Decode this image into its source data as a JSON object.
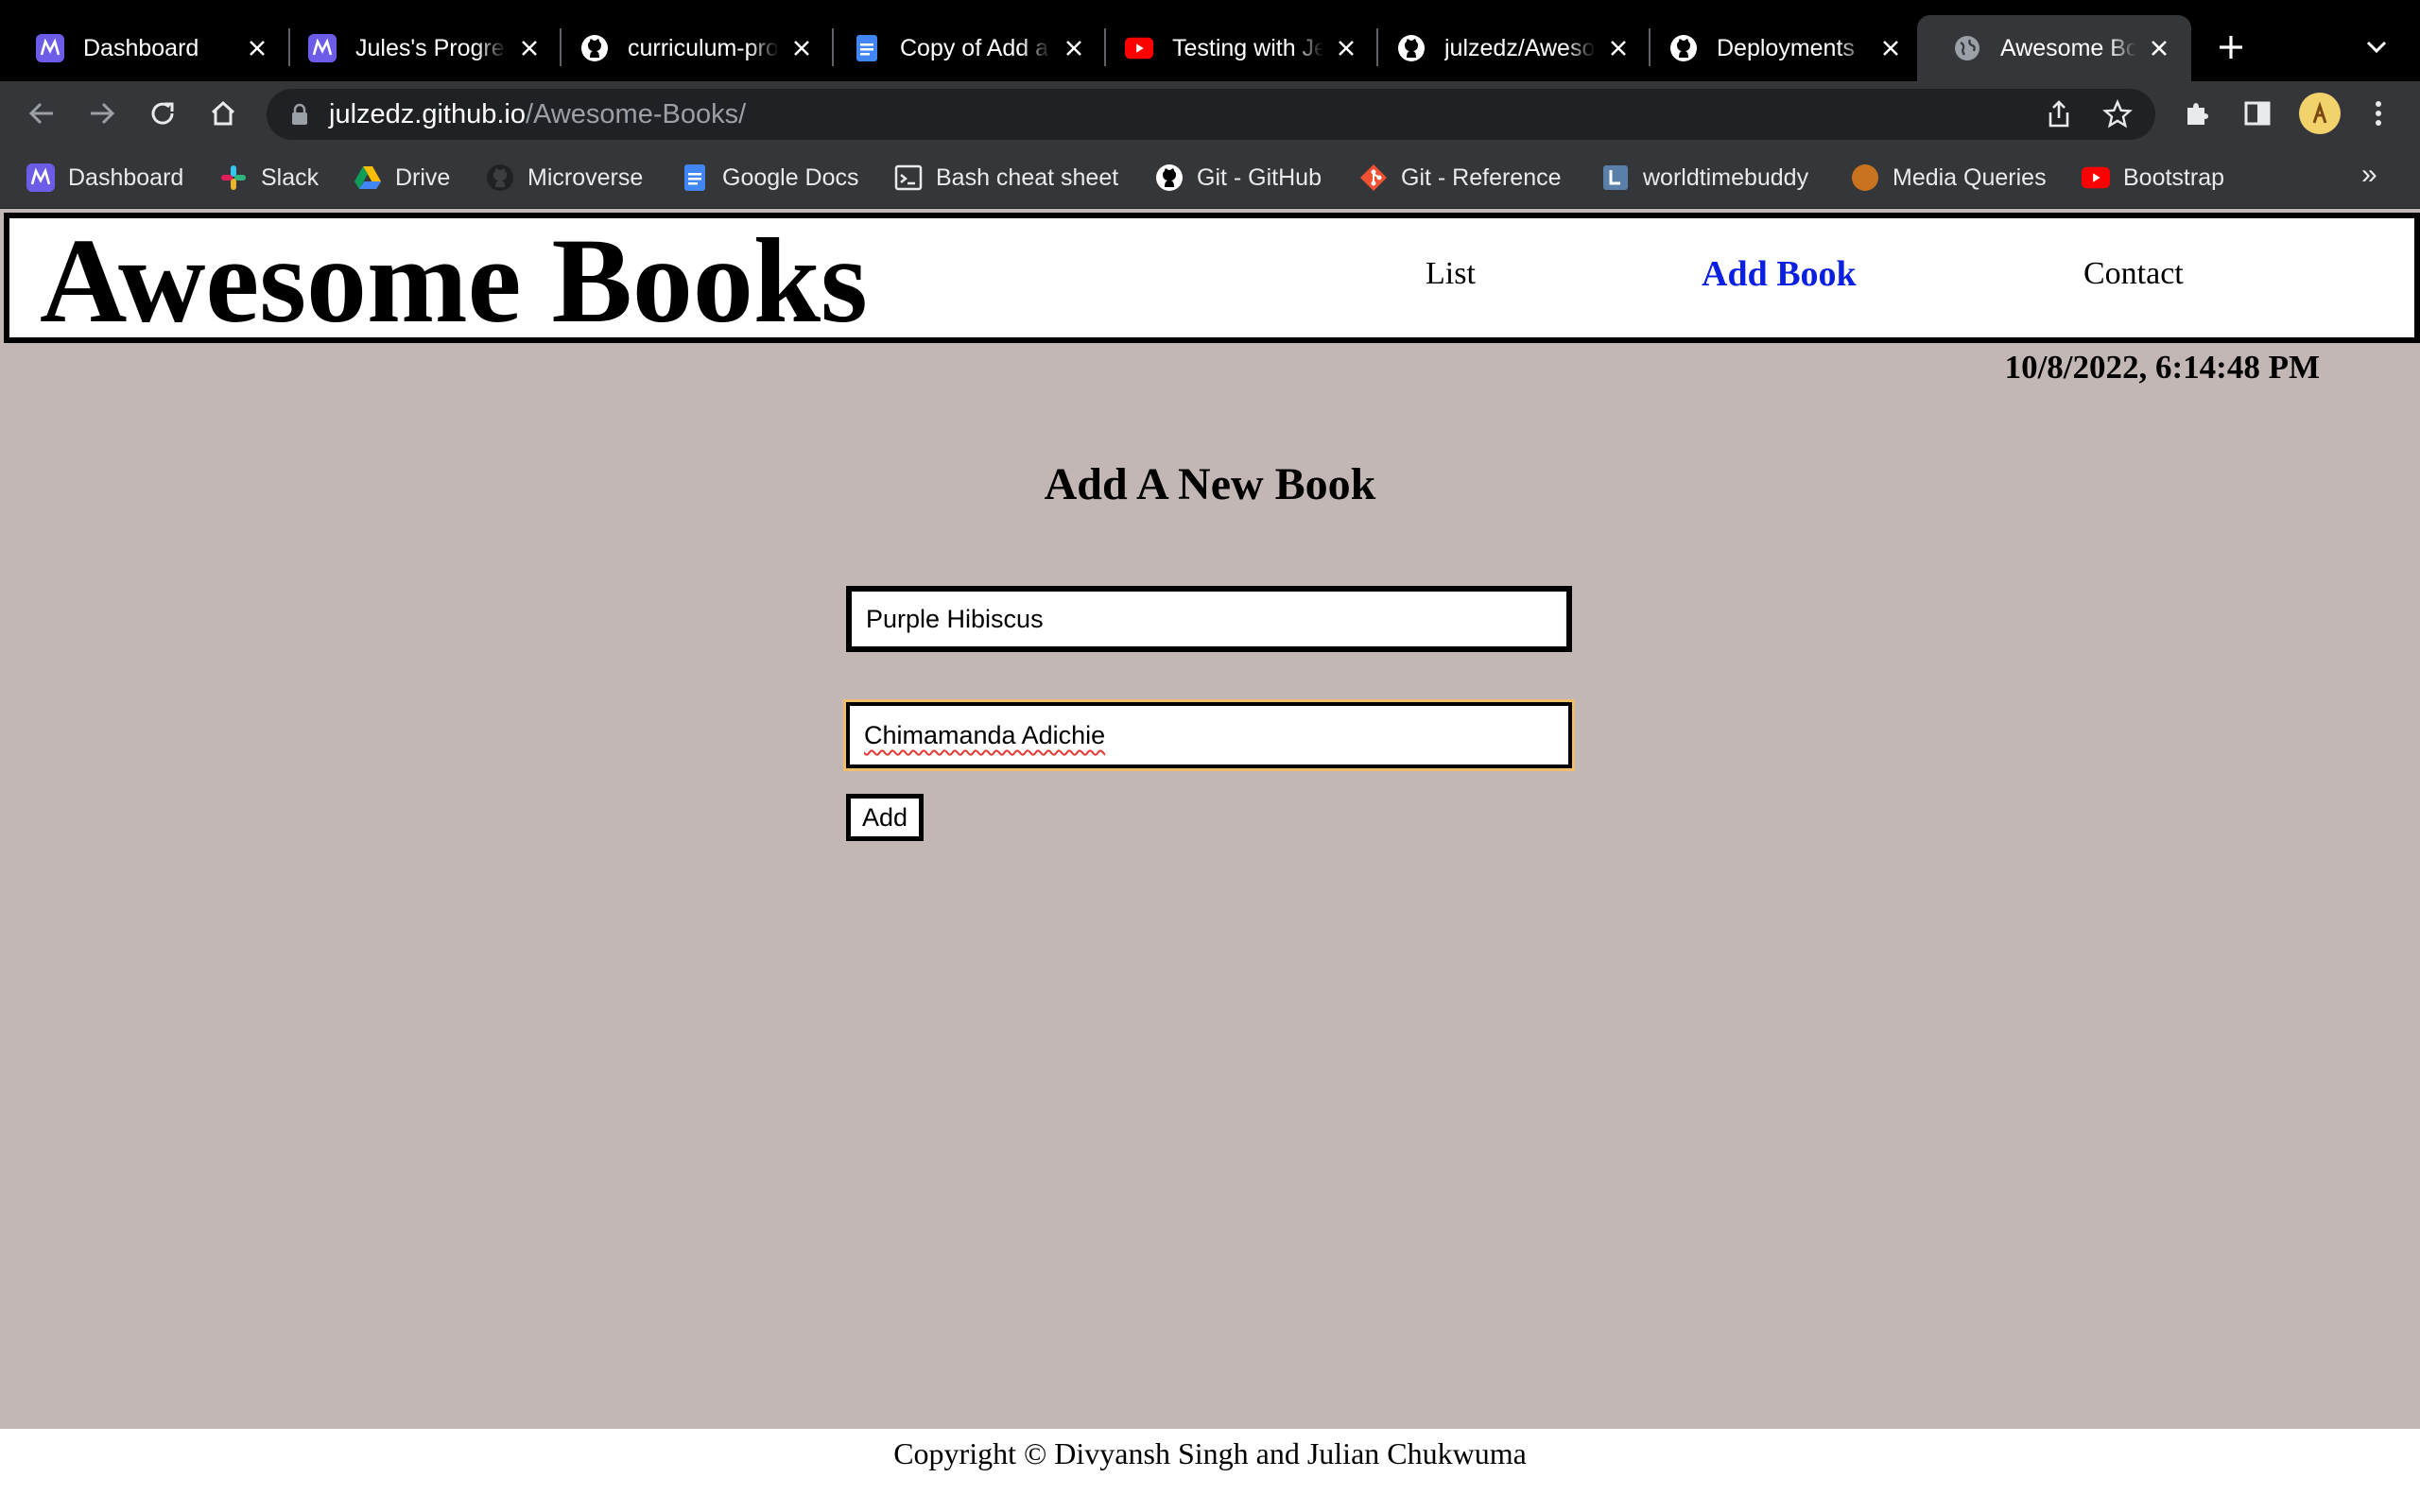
{
  "browser": {
    "tabs": [
      {
        "title": "Dashboard",
        "icon": "microverse-icon"
      },
      {
        "title": "Jules's Progress",
        "icon": "microverse-icon"
      },
      {
        "title": "curriculum-products",
        "icon": "github-icon"
      },
      {
        "title": "Copy of Add a",
        "icon": "google-docs-icon"
      },
      {
        "title": "Testing with Jest",
        "icon": "youtube-icon"
      },
      {
        "title": "julzedz/Awesome",
        "icon": "github-icon"
      },
      {
        "title": "Deployments",
        "icon": "github-icon"
      },
      {
        "title": "Awesome Books",
        "icon": "globe-icon",
        "active": true
      }
    ],
    "url_host": "julzedz.github.io",
    "url_path": "/Awesome-Books/",
    "bookmarks": [
      {
        "label": "Dashboard",
        "icon": "microverse-icon"
      },
      {
        "label": "Slack",
        "icon": "slack-icon"
      },
      {
        "label": "Drive",
        "icon": "google-drive-icon"
      },
      {
        "label": "Microverse",
        "icon": "github-icon"
      },
      {
        "label": "Google Docs",
        "icon": "google-docs-icon"
      },
      {
        "label": "Bash cheat sheet",
        "icon": "terminal-icon"
      },
      {
        "label": "Git - GitHub",
        "icon": "github-icon"
      },
      {
        "label": "Git - Reference",
        "icon": "git-icon"
      },
      {
        "label": "worldtimebuddy",
        "icon": "worldtimebuddy-icon"
      },
      {
        "label": "Media Queries",
        "icon": "orange-circle-icon"
      },
      {
        "label": "Bootstrap",
        "icon": "youtube-icon"
      }
    ],
    "bookmarks_more": "»"
  },
  "site": {
    "logo": "Awesome Books",
    "nav": {
      "list": "List",
      "add": "Add Book",
      "contact": "Contact"
    },
    "datetime": "10/8/2022, 6:14:48 PM",
    "form": {
      "heading": "Add A New Book",
      "title_value": "Purple Hibiscus",
      "author_value": "Chimamanda Adichie",
      "add_label": "Add"
    },
    "footer": "Copyright © Divyansh Singh and Julian Chukwuma"
  },
  "colors": {
    "page_bg": "#c3b7b6",
    "active_nav": "#0a1fe0",
    "focus_ring": "#f0bd6d",
    "chrome_dark": "#35363a"
  }
}
